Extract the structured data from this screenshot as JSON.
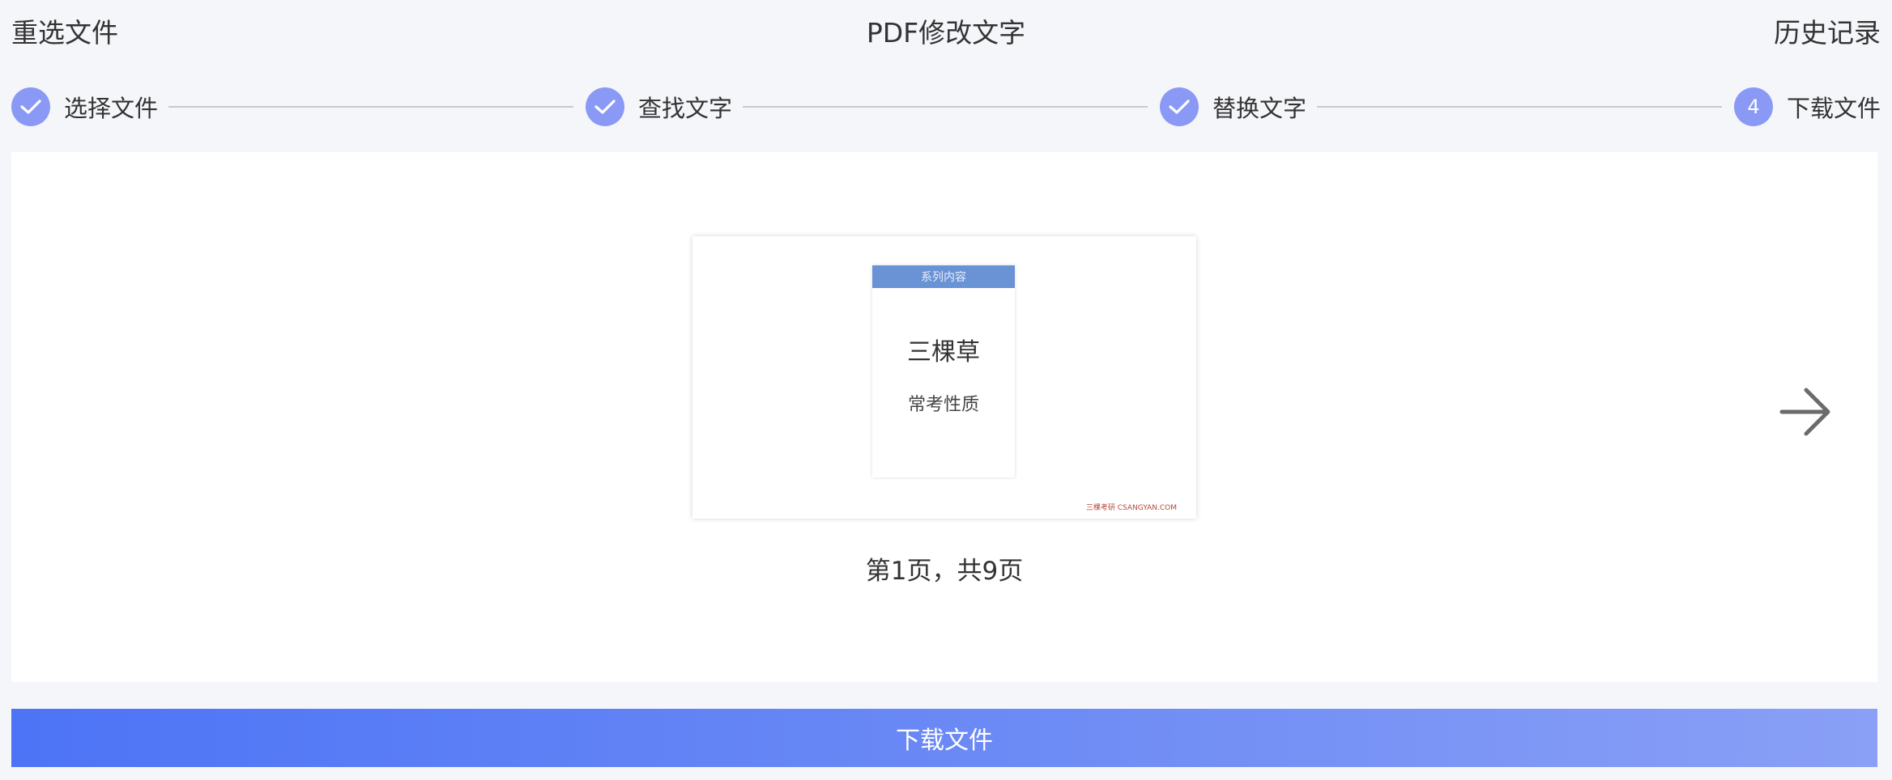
{
  "header": {
    "reselect_label": "重选文件",
    "title": "PDF修改文字",
    "history_label": "历史记录"
  },
  "steps": [
    {
      "label": "选择文件",
      "state": "done",
      "icon": "check-icon"
    },
    {
      "label": "查找文字",
      "state": "done",
      "icon": "check-icon"
    },
    {
      "label": "替换文字",
      "state": "done",
      "icon": "check-icon"
    },
    {
      "label": "下载文件",
      "state": "current",
      "number": "4"
    }
  ],
  "preview": {
    "slide_header": "系列内容",
    "slide_title": "三棵草",
    "slide_subtitle": "常考性质",
    "watermark": "三棵考研 CSANGYAN.COM",
    "page_info": "第1页，共9页",
    "next_icon": "arrow-right-icon"
  },
  "footer": {
    "download_label": "下载文件"
  },
  "colors": {
    "accent": "#8a99f5",
    "button_start": "#4d74f6",
    "button_end": "#8aa0f6",
    "slide_header": "#6a93d6"
  }
}
